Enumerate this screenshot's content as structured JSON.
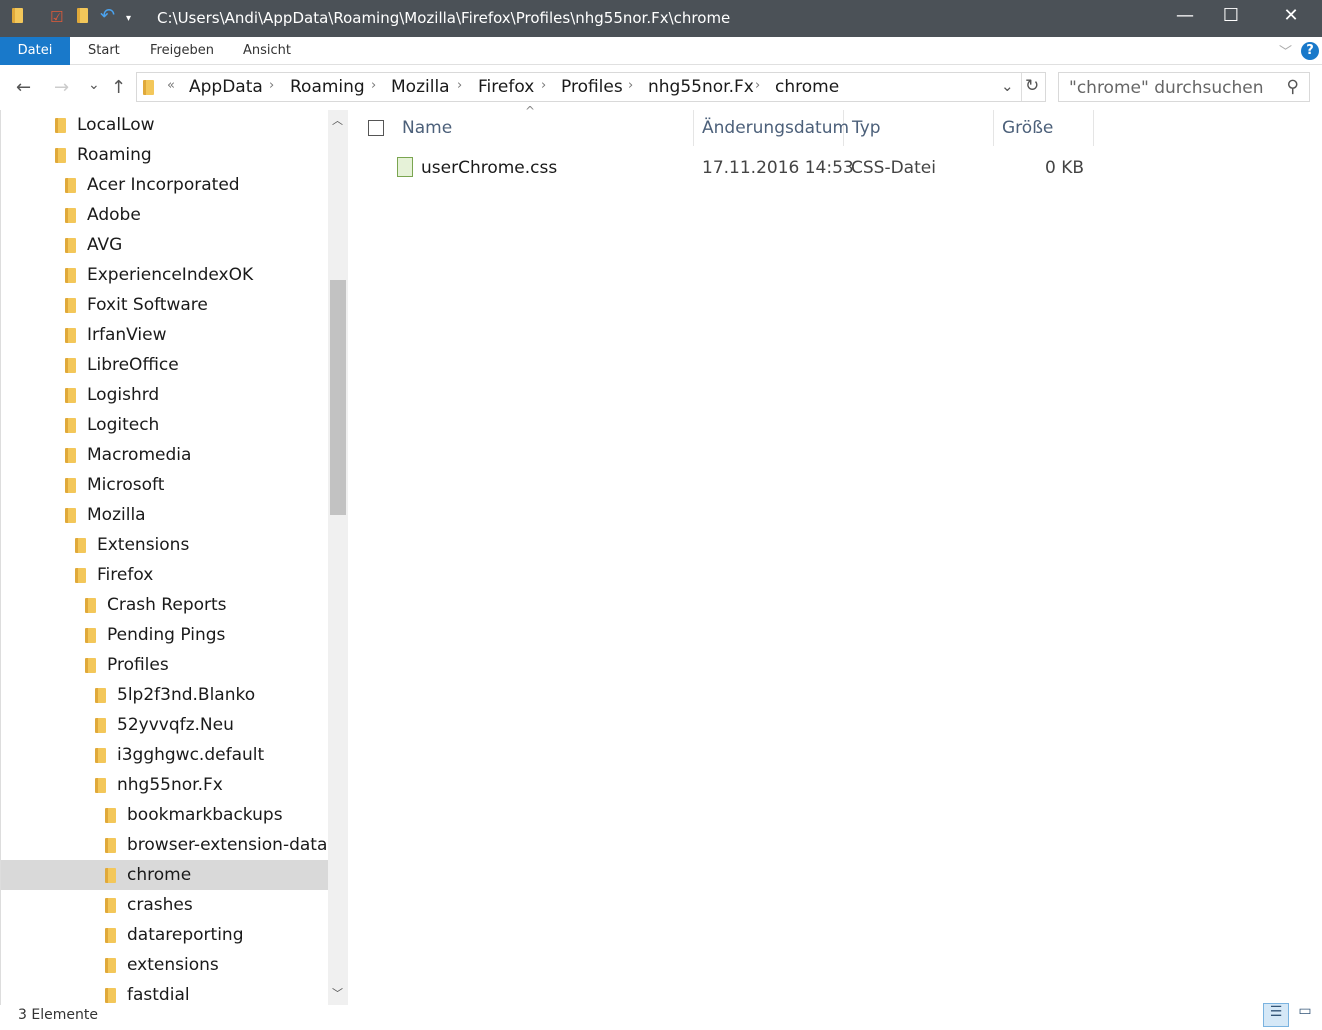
{
  "window": {
    "title": "C:\\Users\\Andi\\AppData\\Roaming\\Mozilla\\Firefox\\Profiles\\nhg55nor.Fx\\chrome",
    "minimize": "—",
    "maximize": "☐",
    "close": "✕"
  },
  "ribbon": {
    "tabs": [
      "Datei",
      "Start",
      "Freigeben",
      "Ansicht"
    ],
    "help": "?",
    "expand": "﹀"
  },
  "nav": {
    "back": "←",
    "forward": "→",
    "recent": "⌄",
    "up": "↑",
    "refresh": "↻",
    "overflow": "«",
    "dropdown": "⌄"
  },
  "breadcrumb": [
    "AppData",
    "Roaming",
    "Mozilla",
    "Firefox",
    "Profiles",
    "nhg55nor.Fx",
    "chrome"
  ],
  "search": {
    "placeholder": "\"chrome\" durchsuchen",
    "icon": "⚲"
  },
  "tree": [
    {
      "label": "LocalLow",
      "level": 0
    },
    {
      "label": "Roaming",
      "level": 0
    },
    {
      "label": "Acer Incorporated",
      "level": 1
    },
    {
      "label": "Adobe",
      "level": 1
    },
    {
      "label": "AVG",
      "level": 1
    },
    {
      "label": "ExperienceIndexOK",
      "level": 1
    },
    {
      "label": "Foxit Software",
      "level": 1
    },
    {
      "label": "IrfanView",
      "level": 1
    },
    {
      "label": "LibreOffice",
      "level": 1
    },
    {
      "label": "Logishrd",
      "level": 1
    },
    {
      "label": "Logitech",
      "level": 1
    },
    {
      "label": "Macromedia",
      "level": 1
    },
    {
      "label": "Microsoft",
      "level": 1
    },
    {
      "label": "Mozilla",
      "level": 1
    },
    {
      "label": "Extensions",
      "level": 2
    },
    {
      "label": "Firefox",
      "level": 2
    },
    {
      "label": "Crash Reports",
      "level": 3
    },
    {
      "label": "Pending Pings",
      "level": 3
    },
    {
      "label": "Profiles",
      "level": 3
    },
    {
      "label": "5lp2f3nd.Blanko",
      "level": 4
    },
    {
      "label": "52yvvqfz.Neu",
      "level": 4
    },
    {
      "label": "i3gghgwc.default",
      "level": 4
    },
    {
      "label": "nhg55nor.Fx",
      "level": 4
    },
    {
      "label": "bookmarkbackups",
      "level": 5
    },
    {
      "label": "browser-extension-data",
      "level": 5
    },
    {
      "label": "chrome",
      "level": 5,
      "selected": true
    },
    {
      "label": "crashes",
      "level": 5
    },
    {
      "label": "datareporting",
      "level": 5
    },
    {
      "label": "extensions",
      "level": 5
    },
    {
      "label": "fastdial",
      "level": 5
    }
  ],
  "columns": {
    "name": "Name",
    "date": "Änderungsdatum",
    "type": "Typ",
    "size": "Größe"
  },
  "files": [
    {
      "name": "userChrome.css",
      "date": "17.11.2016 14:53",
      "type": "CSS-Datei",
      "size": "0 KB"
    }
  ],
  "status": {
    "count": "3 Elemente"
  }
}
